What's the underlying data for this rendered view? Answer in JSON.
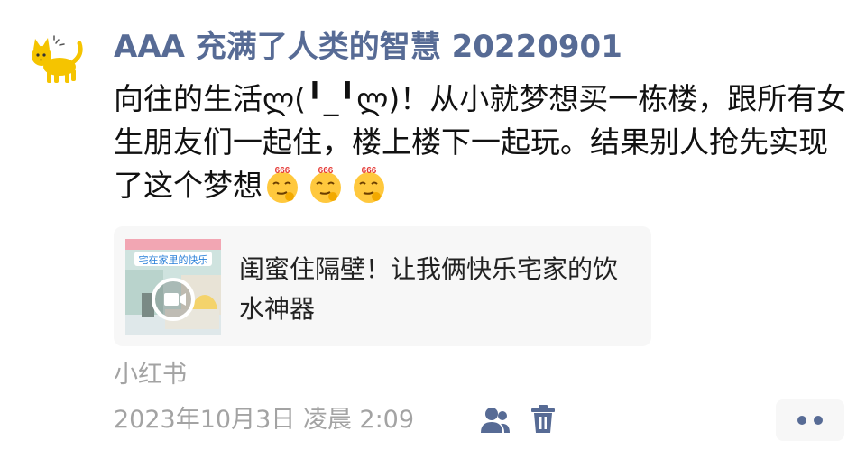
{
  "moment": {
    "author": "AAA 充满了人类的智慧 20220901",
    "text_before_emoji": "向往的生活ლ(╹_╹ლ)！从小就梦想买一栋楼，跟所有女生朋友们一起住，楼上楼下一起玩。结果别人抢先实现了这个梦想",
    "emoji_label": "666",
    "link_card": {
      "title": "闺蜜住隔壁！让我俩快乐宅家的饮水神器",
      "thumbnail_caption": "宅在家里的快乐"
    },
    "source": "小红书",
    "timestamp": "2023年10月3日 凌晨 2:09"
  },
  "icons": {
    "avatar": "cat-avatar-icon",
    "visibility": "friends-icon",
    "delete": "trash-icon",
    "more": "more-dots-icon",
    "play": "video-play-icon"
  },
  "colors": {
    "author_name": "#576b95",
    "meta_text": "#a3a3a3",
    "card_background": "#f7f7f7"
  }
}
